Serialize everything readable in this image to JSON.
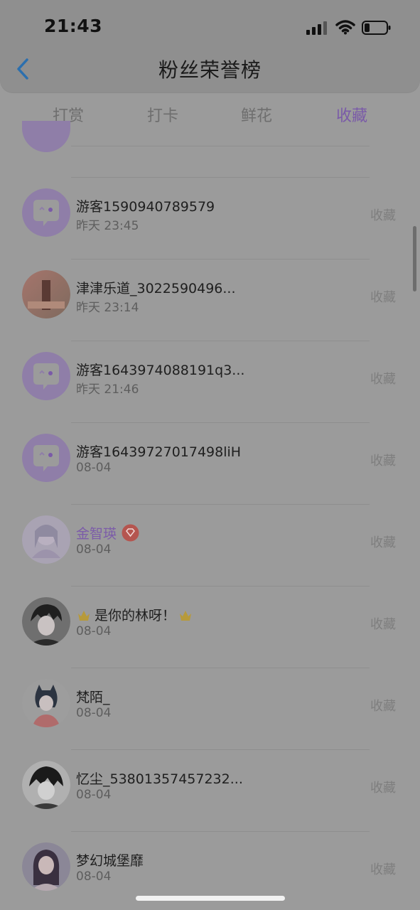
{
  "status": {
    "time": "21:43"
  },
  "header": {
    "title": "粉丝荣誉榜"
  },
  "tabs": [
    {
      "label": "打赏",
      "active": false
    },
    {
      "label": "打卡",
      "active": false
    },
    {
      "label": "鲜花",
      "active": false
    },
    {
      "label": "收藏",
      "active": true
    }
  ],
  "colors": {
    "accent": "#7a5aa8",
    "background": "#9b9b9b"
  },
  "fans": [
    {
      "name": "游客1590940789579",
      "time": "昨天 23:45",
      "action": "收藏",
      "avatar": "guest-chat-bubble"
    },
    {
      "name": "津津乐道_3022590496...",
      "time": "昨天 23:14",
      "action": "收藏",
      "avatar": "photo"
    },
    {
      "name": "游客1643974088191q3...",
      "time": "昨天 21:46",
      "action": "收藏",
      "avatar": "guest-chat-bubble"
    },
    {
      "name": "游客16439727017498liH",
      "time": "08-04",
      "action": "收藏",
      "avatar": "guest-chat-bubble"
    },
    {
      "name": "金智瑛",
      "time": "08-04",
      "action": "收藏",
      "avatar": "anime-girl",
      "vip": true,
      "badge": "diamond-badge-icon"
    },
    {
      "name": "是你的林呀！",
      "time": "08-04",
      "action": "收藏",
      "avatar": "anime-boy",
      "decor": "crown-icon"
    },
    {
      "name": "梵陌_",
      "time": "08-04",
      "action": "收藏",
      "avatar": "cat-girl"
    },
    {
      "name": "忆尘_53801357457232...",
      "time": "08-04",
      "action": "收藏",
      "avatar": "sketch-boy"
    },
    {
      "name": "梦幻城堡靡",
      "time": "08-04",
      "action": "收藏",
      "avatar": "girl-photo"
    }
  ]
}
